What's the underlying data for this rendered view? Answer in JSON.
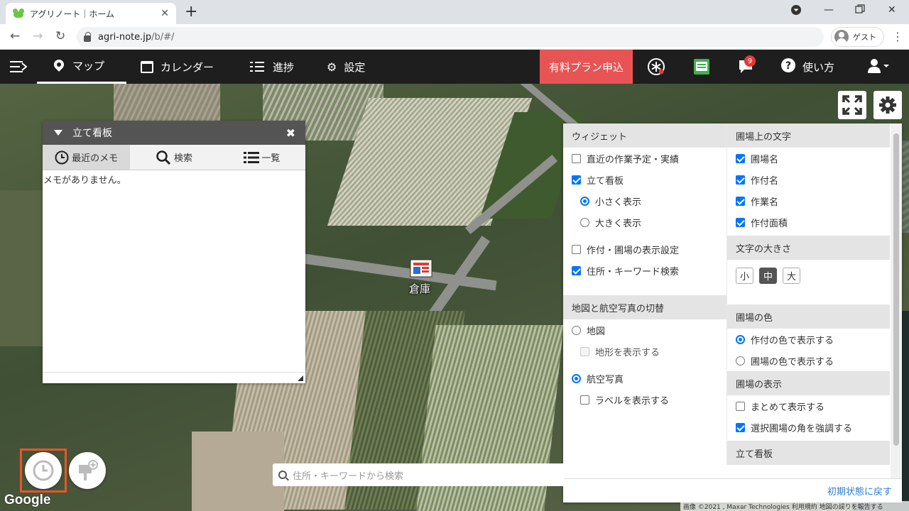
{
  "browser": {
    "tab_title": "アグリノート｜ホーム",
    "url_host": "agri-note.jp",
    "url_path": "/b/#/",
    "profile_label": "ゲスト"
  },
  "nav": {
    "items": [
      {
        "label": "マップ"
      },
      {
        "label": "カレンダー"
      },
      {
        "label": "進捗"
      },
      {
        "label": "設定"
      }
    ],
    "paid_plan": "有料プラン申込",
    "notification_count": "9",
    "help": "使い方"
  },
  "board": {
    "title": "立て看板",
    "tabs": [
      "最近のメモ",
      "検索",
      "一覧"
    ],
    "empty_message": "メモがありません。"
  },
  "settings": {
    "widget": {
      "header": "ウィジェット",
      "items": [
        {
          "label": "直近の作業予定・実績",
          "checked": false
        },
        {
          "label": "立て看板",
          "checked": true
        },
        {
          "label": "小さく表示",
          "checked": true
        },
        {
          "label": "大きく表示",
          "checked": false
        },
        {
          "label": "作付・圃場の表示設定",
          "checked": false
        },
        {
          "label": "住所・キーワード検索",
          "checked": true
        }
      ]
    },
    "field_text": {
      "header": "圃場上の文字",
      "items": [
        {
          "label": "圃場名",
          "checked": true
        },
        {
          "label": "作付名",
          "checked": true
        },
        {
          "label": "作業名",
          "checked": true
        },
        {
          "label": "作付面積",
          "checked": true
        }
      ]
    },
    "text_size": {
      "header": "文字の大きさ",
      "options": [
        "小",
        "中",
        "大"
      ],
      "selected": "中"
    },
    "map_toggle": {
      "header": "地図と航空写真の切替",
      "items": [
        {
          "label": "地図",
          "checked": false
        },
        {
          "label": "地形を表示する",
          "checked": false
        },
        {
          "label": "航空写真",
          "checked": true
        },
        {
          "label": "ラベルを表示する",
          "checked": false
        }
      ]
    },
    "field_color": {
      "header": "圃場の色",
      "items": [
        {
          "label": "作付の色で表示する",
          "checked": true
        },
        {
          "label": "圃場の色で表示する",
          "checked": false
        }
      ]
    },
    "field_display": {
      "header": "圃場の表示",
      "items": [
        {
          "label": "まとめて表示する",
          "checked": false
        },
        {
          "label": "選択圃場の角を強調する",
          "checked": true
        }
      ]
    },
    "sign_board_header": "立て看板",
    "reset": "初期状態に戻す"
  },
  "map": {
    "place_label": "倉庫",
    "search_placeholder": "住所・キーワードから検索",
    "attribution": "画像 ©2021 , Maxar Technologies   利用規約   地図の誤りを報告する",
    "google": "Google"
  },
  "colors": {
    "accent_red": "#e85454",
    "nav_bg": "#1e1e1e",
    "link_blue": "#2a7fd4",
    "highlight_orange": "#e8552a"
  }
}
